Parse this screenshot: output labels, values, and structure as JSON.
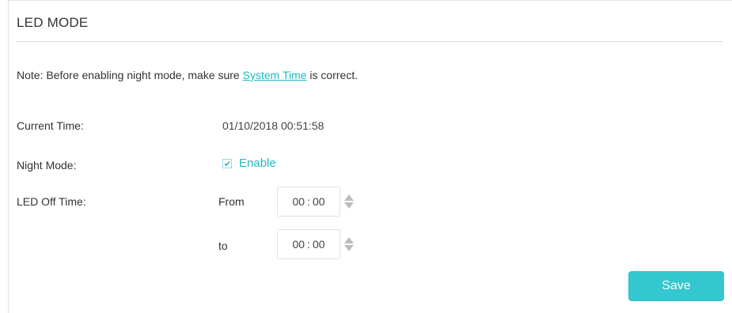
{
  "section": {
    "title": "LED MODE"
  },
  "note": {
    "prefix": "Note: Before enabling night mode, make sure ",
    "link_text": "System Time",
    "suffix": " is correct."
  },
  "current_time": {
    "label": "Current Time:",
    "value": "01/10/2018 00:51:58"
  },
  "night_mode": {
    "label": "Night Mode:",
    "checkbox_label": "Enable",
    "checked": true
  },
  "led_off_time": {
    "label": "LED Off Time:",
    "from_label": "From",
    "to_label": "to",
    "from_hours": "00",
    "from_minutes": "00",
    "to_hours": "00",
    "to_minutes": "00",
    "separator": ":"
  },
  "actions": {
    "save_label": "Save"
  },
  "colors": {
    "accent": "#1fb8c3",
    "button": "#33c7cf",
    "text": "#333333"
  },
  "icons": {
    "checkbox": "check-icon",
    "spinner_up": "caret-up-icon",
    "spinner_down": "caret-down-icon"
  }
}
